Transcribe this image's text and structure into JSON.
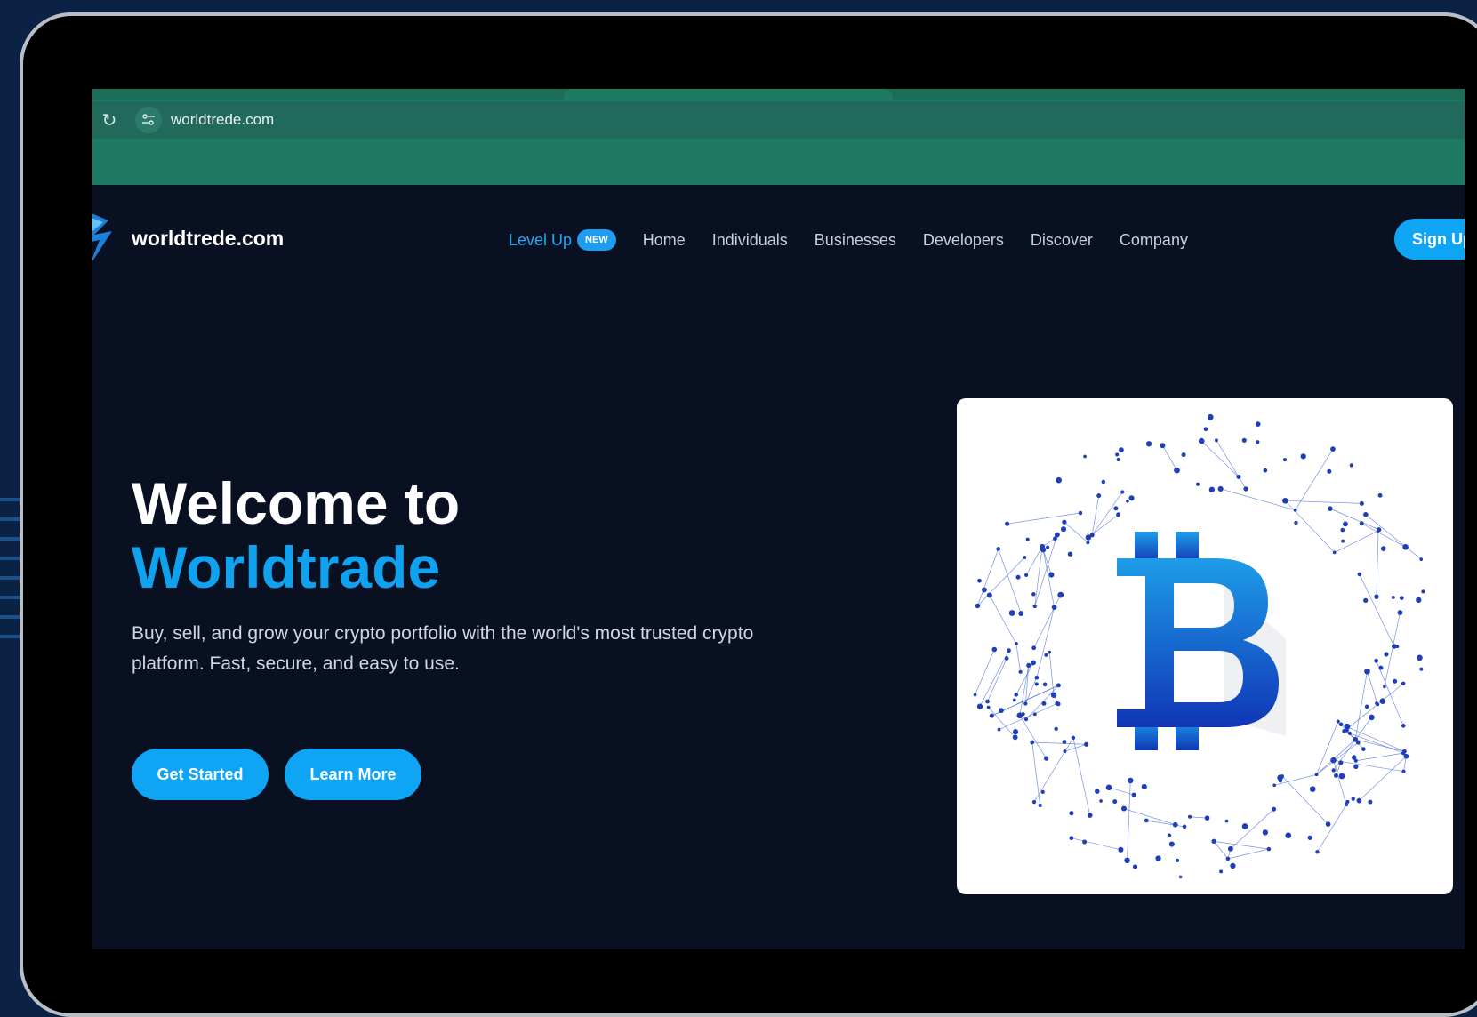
{
  "browser": {
    "url": "worldtrede.com"
  },
  "nav": {
    "brand": "worldtrede.com",
    "level_up": "Level Up",
    "badge": "NEW",
    "items": [
      "Home",
      "Individuals",
      "Businesses",
      "Developers",
      "Discover",
      "Company"
    ],
    "signup": "Sign Up"
  },
  "hero": {
    "title_line1": "Welcome to",
    "title_line2": "Worldtrade",
    "subtitle": "Buy, sell, and grow your crypto portfolio with the world's most trusted crypto platform. Fast, secure, and easy to use.",
    "primary_button": "Get Started",
    "secondary_button": "Learn More"
  },
  "colors": {
    "accent": "#0ea5f5",
    "page_bg": "#091022",
    "chrome_bg": "#1f7a62",
    "device_bg": "#0b2244"
  },
  "icons": [
    "reload-icon",
    "site-info-icon",
    "brand-logo-icon",
    "bitcoin-network-image"
  ]
}
